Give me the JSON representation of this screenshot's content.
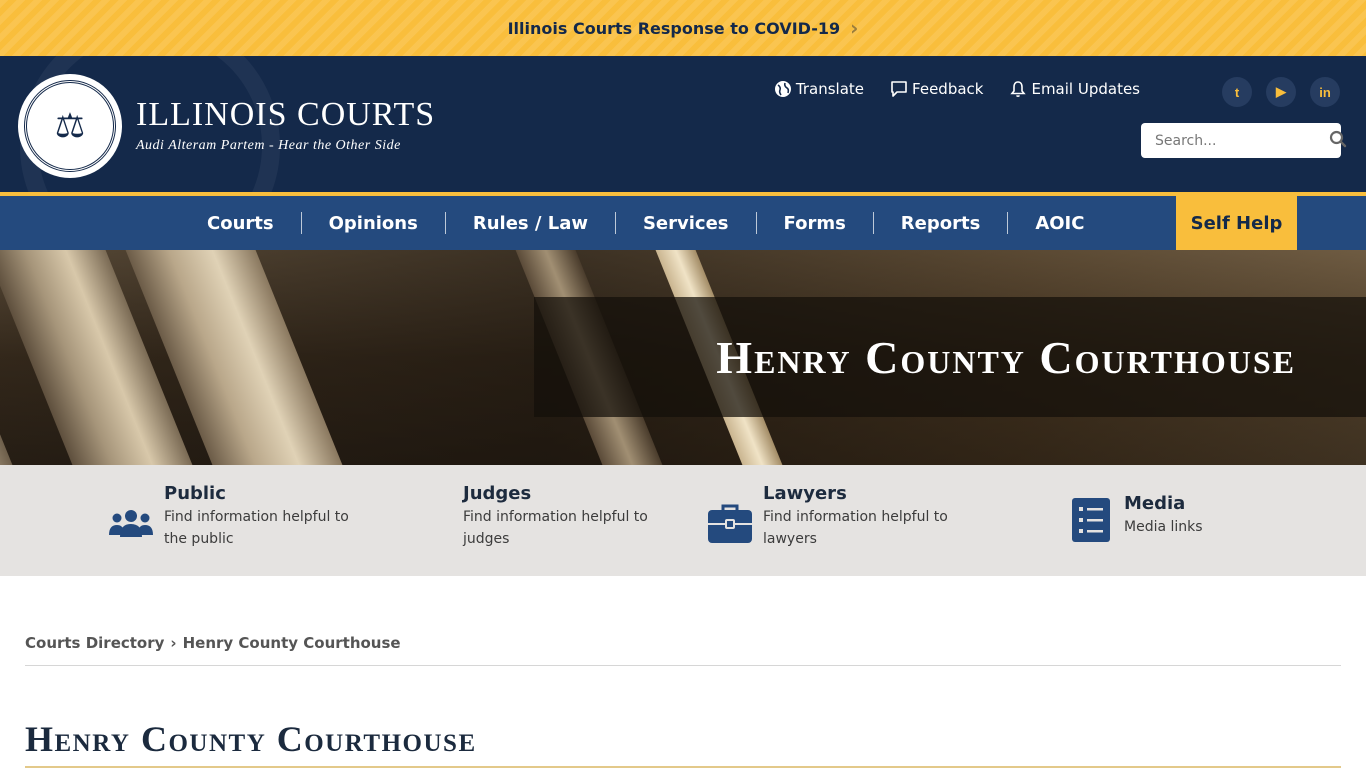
{
  "alert": {
    "text": "Illinois Courts Response to COVID-19",
    "chevron": "›"
  },
  "brand": {
    "title": "Illinois Courts",
    "subtitle": "Audi Alteram Partem - Hear the Other Side",
    "seal_text": "⚖"
  },
  "utility": {
    "translate": "Translate",
    "feedback": "Feedback",
    "email_updates": "Email Updates"
  },
  "socials": [
    {
      "name": "twitter-icon",
      "glyph": "t"
    },
    {
      "name": "youtube-icon",
      "glyph": "▶"
    },
    {
      "name": "linkedin-icon",
      "glyph": "in"
    }
  ],
  "search": {
    "placeholder": "Search..."
  },
  "nav": {
    "items": [
      "Courts",
      "Opinions",
      "Rules / Law",
      "Services",
      "Forms",
      "Reports",
      "AOIC"
    ],
    "self_help": "Self Help"
  },
  "hero": {
    "title": "Henry County Courthouse"
  },
  "audience": [
    {
      "title": "Public",
      "desc": "Find information helpful to the public"
    },
    {
      "title": "Judges",
      "desc": "Find information helpful to judges"
    },
    {
      "title": "Lawyers",
      "desc": "Find information helpful to lawyers"
    },
    {
      "title": "Media",
      "desc": "Media links"
    }
  ],
  "breadcrumb": {
    "parent": "Courts Directory",
    "separator": "›",
    "current": "Henry County Courthouse"
  },
  "page": {
    "title": "Henry County Courthouse"
  },
  "colors": {
    "navy": "#14294a",
    "gold": "#f9be3c",
    "nav_blue": "#244a7e",
    "audience_bg": "#e5e3e1"
  }
}
